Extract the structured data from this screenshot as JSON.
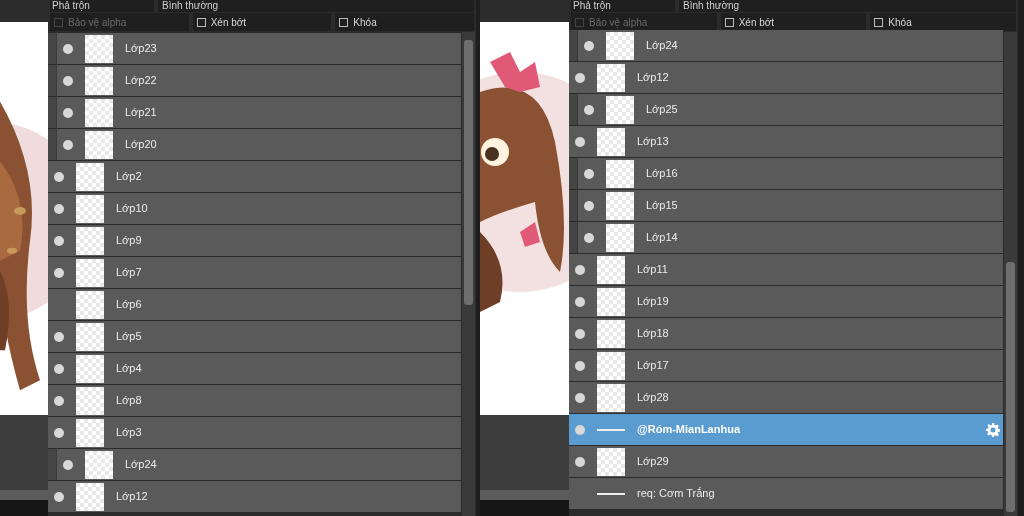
{
  "panels": [
    {
      "blend_label": "Phả trộn",
      "blend_mode": "Bình thường",
      "options": [
        {
          "label": "Bảo vệ alpha",
          "checked": false,
          "disabled": true
        },
        {
          "label": "Xén bớt",
          "checked": false,
          "disabled": false
        },
        {
          "label": "Khóa",
          "checked": false,
          "disabled": false
        }
      ],
      "layers": [
        {
          "name": "Lớp23",
          "visible": true,
          "clipped": true,
          "selected": false,
          "kind": "layer"
        },
        {
          "name": "Lớp22",
          "visible": true,
          "clipped": true,
          "selected": false,
          "kind": "layer"
        },
        {
          "name": "Lớp21",
          "visible": true,
          "clipped": true,
          "selected": false,
          "kind": "layer"
        },
        {
          "name": "Lớp20",
          "visible": true,
          "clipped": true,
          "selected": false,
          "kind": "layer"
        },
        {
          "name": "Lớp2",
          "visible": true,
          "clipped": false,
          "selected": false,
          "kind": "layer"
        },
        {
          "name": "Lớp10",
          "visible": true,
          "clipped": false,
          "selected": false,
          "kind": "layer"
        },
        {
          "name": "Lớp9",
          "visible": true,
          "clipped": false,
          "selected": false,
          "kind": "layer"
        },
        {
          "name": "Lớp7",
          "visible": true,
          "clipped": false,
          "selected": false,
          "kind": "layer"
        },
        {
          "name": "Lớp6",
          "visible": false,
          "clipped": false,
          "selected": false,
          "kind": "layer"
        },
        {
          "name": "Lớp5",
          "visible": true,
          "clipped": false,
          "selected": false,
          "kind": "layer"
        },
        {
          "name": "Lớp4",
          "visible": true,
          "clipped": false,
          "selected": false,
          "kind": "layer"
        },
        {
          "name": "Lớp8",
          "visible": true,
          "clipped": false,
          "selected": false,
          "kind": "layer"
        },
        {
          "name": "Lớp3",
          "visible": true,
          "clipped": false,
          "selected": false,
          "kind": "layer"
        },
        {
          "name": "Lớp24",
          "visible": true,
          "clipped": true,
          "selected": false,
          "kind": "layer"
        },
        {
          "name": "Lớp12",
          "visible": true,
          "clipped": false,
          "selected": false,
          "kind": "layer"
        }
      ]
    },
    {
      "blend_label": "Phả trộn",
      "blend_mode": "Bình thường",
      "options": [
        {
          "label": "Bảo vệ alpha",
          "checked": false,
          "disabled": true
        },
        {
          "label": "Xén bớt",
          "checked": false,
          "disabled": false
        },
        {
          "label": "Khóa",
          "checked": false,
          "disabled": false
        }
      ],
      "layers": [
        {
          "name": "Lớp24",
          "visible": true,
          "clipped": true,
          "selected": false,
          "kind": "layer"
        },
        {
          "name": "Lớp12",
          "visible": true,
          "clipped": false,
          "selected": false,
          "kind": "layer"
        },
        {
          "name": "Lớp25",
          "visible": true,
          "clipped": true,
          "selected": false,
          "kind": "layer"
        },
        {
          "name": "Lớp13",
          "visible": true,
          "clipped": false,
          "selected": false,
          "kind": "layer"
        },
        {
          "name": "Lớp16",
          "visible": true,
          "clipped": true,
          "selected": false,
          "kind": "layer"
        },
        {
          "name": "Lớp15",
          "visible": true,
          "clipped": true,
          "selected": false,
          "kind": "layer"
        },
        {
          "name": "Lớp14",
          "visible": true,
          "clipped": true,
          "selected": false,
          "kind": "layer"
        },
        {
          "name": "Lớp11",
          "visible": true,
          "clipped": false,
          "selected": false,
          "kind": "layer"
        },
        {
          "name": "Lớp19",
          "visible": true,
          "clipped": false,
          "selected": false,
          "kind": "layer"
        },
        {
          "name": "Lớp18",
          "visible": true,
          "clipped": false,
          "selected": false,
          "kind": "layer"
        },
        {
          "name": "Lớp17",
          "visible": true,
          "clipped": false,
          "selected": false,
          "kind": "layer"
        },
        {
          "name": "Lớp28",
          "visible": true,
          "clipped": false,
          "selected": false,
          "kind": "layer"
        },
        {
          "name": "@Róm-MianLanhua",
          "visible": true,
          "clipped": false,
          "selected": true,
          "kind": "folder"
        },
        {
          "name": "Lớp29",
          "visible": true,
          "clipped": false,
          "selected": false,
          "kind": "layer"
        },
        {
          "name": "req: Cơm Trắng",
          "visible": false,
          "clipped": false,
          "selected": false,
          "kind": "folder"
        }
      ]
    }
  ]
}
